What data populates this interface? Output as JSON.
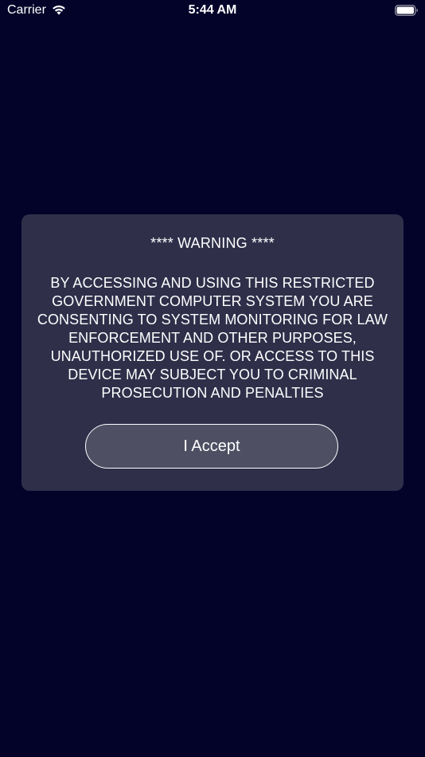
{
  "status_bar": {
    "carrier": "Carrier",
    "time": "5:44 AM",
    "wifi_icon": "wifi-icon",
    "battery_icon": "battery-full-icon"
  },
  "alert": {
    "title": "**** WARNING ****",
    "message": "BY ACCESSING AND USING THIS RESTRICTED GOVERNMENT COMPUTER SYSTEM YOU ARE CONSENTING TO SYSTEM MONITORING FOR LAW ENFORCEMENT AND OTHER PURPOSES, UNAUTHORIZED USE OF. OR ACCESS TO THIS DEVICE MAY SUBJECT YOU TO CRIMINAL PROSECUTION AND PENALTIES",
    "accept_label": "I Accept"
  },
  "colors": {
    "background": "#03032a",
    "card": "#2f2f4a",
    "button": "#4e4f63",
    "text": "#ffffff"
  }
}
